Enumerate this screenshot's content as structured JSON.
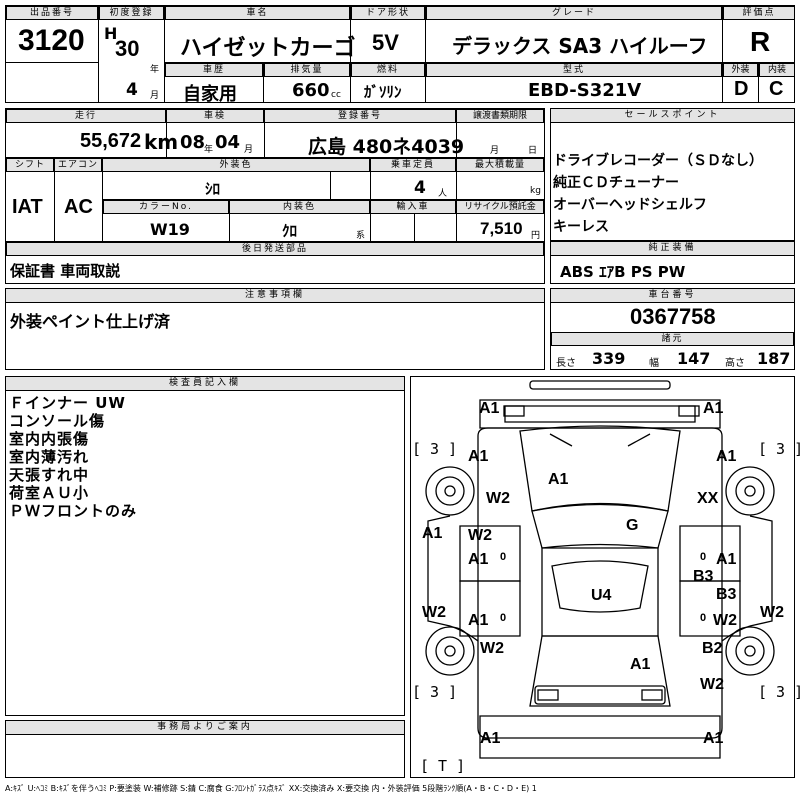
{
  "header": {
    "lot_label": "出品番号",
    "lot": "3120",
    "first_reg_label": "初度登録",
    "era_letter": "H",
    "era_year": "30",
    "year_unit": "年",
    "month": "4",
    "month_unit": "月",
    "history_label": "車歴",
    "history": "自家用",
    "name_label": "車名",
    "name": "ハイゼットカーゴ",
    "displacement_label": "排気量",
    "displacement": "660",
    "cc_unit": "cc",
    "door_label": "ドア形状",
    "door": "5V",
    "fuel_label": "燃料",
    "fuel": "ｶﾞｿﾘﾝ",
    "grade_label": "グレード",
    "grade": "デラックス SA3 ハイルーフ",
    "model_label": "型式",
    "model": "EBD-S321V",
    "score_label": "評価点",
    "score": "R",
    "exterior_label": "外装",
    "exterior": "D",
    "interior_label": "内装",
    "interior": "C"
  },
  "row2": {
    "mileage_label": "走行",
    "mileage": "55,672",
    "km": "km",
    "inspection_label": "車検",
    "insp_year": "08",
    "insp_year_unit": "年",
    "insp_month": "04",
    "insp_month_unit": "月",
    "plate_label": "登録番号",
    "plate": "広島 480ネ4039",
    "transfer_label": "譲渡書類期限",
    "transfer_month_unit": "月",
    "transfer_day_unit": "日",
    "shift_label": "シフト",
    "shift": "IAT",
    "ac_label": "エアコン",
    "ac": "AC",
    "color_label": "外装色",
    "color": "ｼﾛ",
    "capacity_label": "乗車定員",
    "capacity": "4",
    "capacity_unit": "人",
    "load_label": "最大積載量",
    "load_unit": "kg",
    "color_no_label": "カラーNo.",
    "color_no": "W19",
    "int_color_label": "内装色",
    "int_color": "ｸﾛ",
    "int_color_unit": "系",
    "import_label": "輸入車",
    "recycle_label": "リサイクル預託金",
    "recycle": "7,510",
    "recycle_unit": "円",
    "later_label": "後日発送部品",
    "later": "保証書 車両取説",
    "notes_label": "注意事項欄",
    "notes": "外装ペイント仕上げ済"
  },
  "sales": {
    "label": "セールスポイント",
    "items": [
      "ドライブレコーダー（ＳＤなし）",
      "純正ＣＤチューナー",
      "オーバーヘッドシェルフ",
      "キーレス"
    ],
    "equip_label": "純正装備",
    "equip": "ABS ｴｱB PS PW",
    "chassis_label": "車台番号",
    "chassis": "0367758",
    "dims_label": "諸元",
    "len_label": "長さ",
    "len": "339",
    "wid_label": "幅",
    "wid": "147",
    "hei_label": "高さ",
    "hei": "187"
  },
  "inspector": {
    "label": "検査員記入欄",
    "lines": [
      "Ｆインナー UW",
      "コンソール傷",
      "室内内張傷",
      "室内薄汚れ",
      "天張すれ中",
      "荷室ＡＵ小",
      "ＰＷフロントのみ"
    ]
  },
  "office": {
    "label": "事務局よりご案内"
  },
  "diagram": {
    "tire_labels": [
      "[ 3 ]",
      "[ 3 ]",
      "[ 3 ]",
      "[ 3 ]",
      "[ T ]"
    ],
    "marks": {
      "front_bumper_l": "A1",
      "front_bumper_r": "A1",
      "fender_fl": "A1",
      "fender_fr": "A1",
      "hood": "A1",
      "wheel_fl": "W2",
      "wheel_fr": "XX",
      "windshield": "G",
      "side_l": "A1",
      "door_fl_w": "W2",
      "door_fl_a": "A1",
      "door_fl_c": "0",
      "door_fr_c": "0",
      "door_fr_a": "A1",
      "door_fr_b": "B3",
      "door_rr_b": "B3",
      "roof": "U4",
      "side_l2": "W2",
      "door_rl_a": "A1",
      "door_rl_c": "0",
      "door_rr_c": "0",
      "door_rr_w": "W2",
      "side_r2": "W2",
      "wheel_rl": "W2",
      "rear_panel": "A1",
      "quarter_r": "B2",
      "rear_r": "W2",
      "rear_bumper_l": "A1",
      "rear_bumper_r": "A1"
    }
  },
  "legend": "A:ｷｽﾞ U:ﾍｺﾐ B:ｷｽﾞを伴うﾍｺﾐ P:要塗装 W:補修跡 S:錆 C:腐食 G:ﾌﾛﾝﾄｶﾞﾗｽ点ｷｽﾞ XX:交換済み X:要交換 内・外装評価 5段階ﾗﾝｸ順(A・B・C・D・E) 1"
}
